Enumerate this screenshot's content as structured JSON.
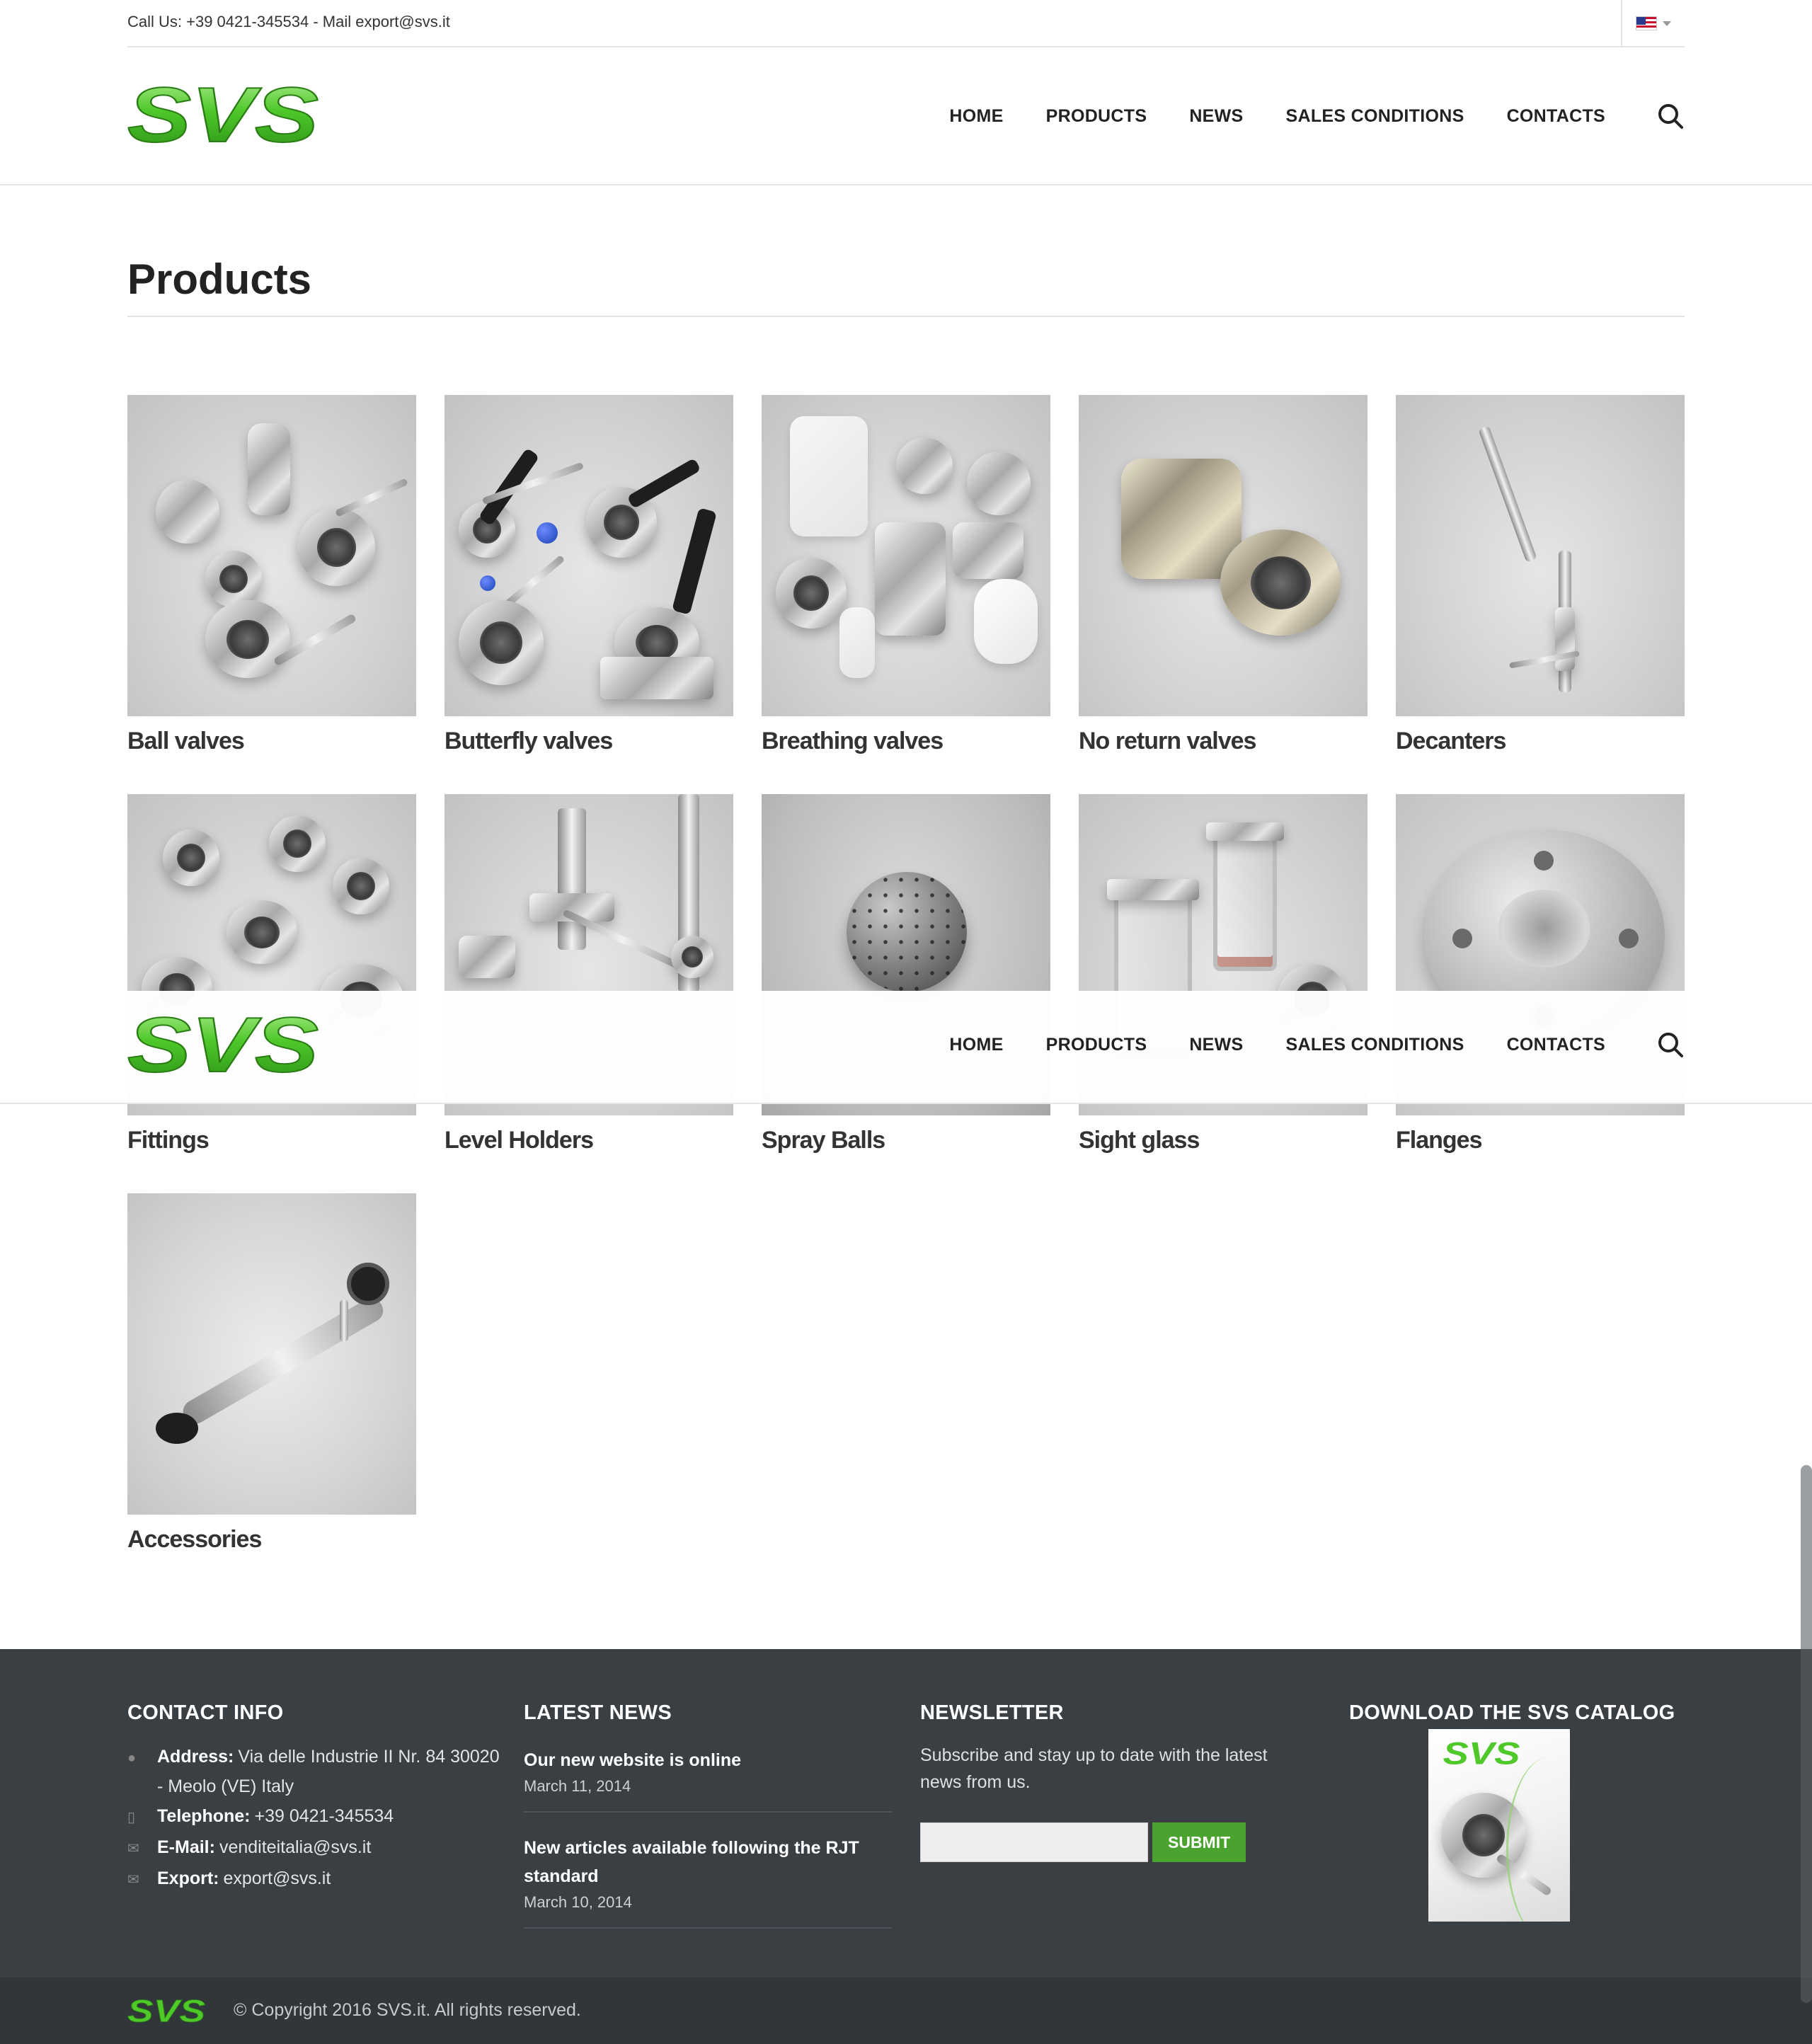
{
  "topbar": {
    "contact_line": "Call Us: +39 0421-345534 - Mail export@svs.it",
    "language_flag": "us-flag-icon"
  },
  "brand": {
    "logo_text": "SVS",
    "logo_color": "#4caf2a"
  },
  "nav": {
    "items": [
      "HOME",
      "PRODUCTS",
      "NEWS",
      "SALES CONDITIONS",
      "CONTACTS"
    ],
    "search_icon": "search-icon"
  },
  "page": {
    "title": "Products"
  },
  "products": [
    {
      "label": "Ball valves"
    },
    {
      "label": "Butterfly valves"
    },
    {
      "label": "Breathing valves"
    },
    {
      "label": "No return valves"
    },
    {
      "label": "Decanters"
    },
    {
      "label": "Fittings"
    },
    {
      "label": "Level Holders"
    },
    {
      "label": "Spray Balls"
    },
    {
      "label": "Sight glass"
    },
    {
      "label": "Flanges"
    },
    {
      "label": "Accessories"
    }
  ],
  "footer": {
    "contact": {
      "heading": "CONTACT INFO",
      "address_label": "Address:",
      "address_line1": "Via delle Industrie II Nr. 84 30020",
      "address_line2": "- Meolo (VE) Italy",
      "telephone_label": "Telephone:",
      "telephone": "+39 0421-345534",
      "email_label": "E-Mail:",
      "email": "venditeitalia@svs.it",
      "export_label": "Export:",
      "export": "export@svs.it"
    },
    "news": {
      "heading": "LATEST NEWS",
      "items": [
        {
          "title": "Our new website is online",
          "date": "March 11, 2014"
        },
        {
          "title": "New articles available following the RJT standard",
          "date": "March 10, 2014"
        }
      ]
    },
    "newsletter": {
      "heading": "NEWSLETTER",
      "text": "Subscribe and stay up to date with the latest news from us.",
      "submit_label": "SUBMIT",
      "submit_color": "#4aa32f"
    },
    "catalog": {
      "heading": "DOWNLOAD THE SVS CATALOG"
    },
    "copyright": "© Copyright 2016 SVS.it. All rights reserved."
  }
}
